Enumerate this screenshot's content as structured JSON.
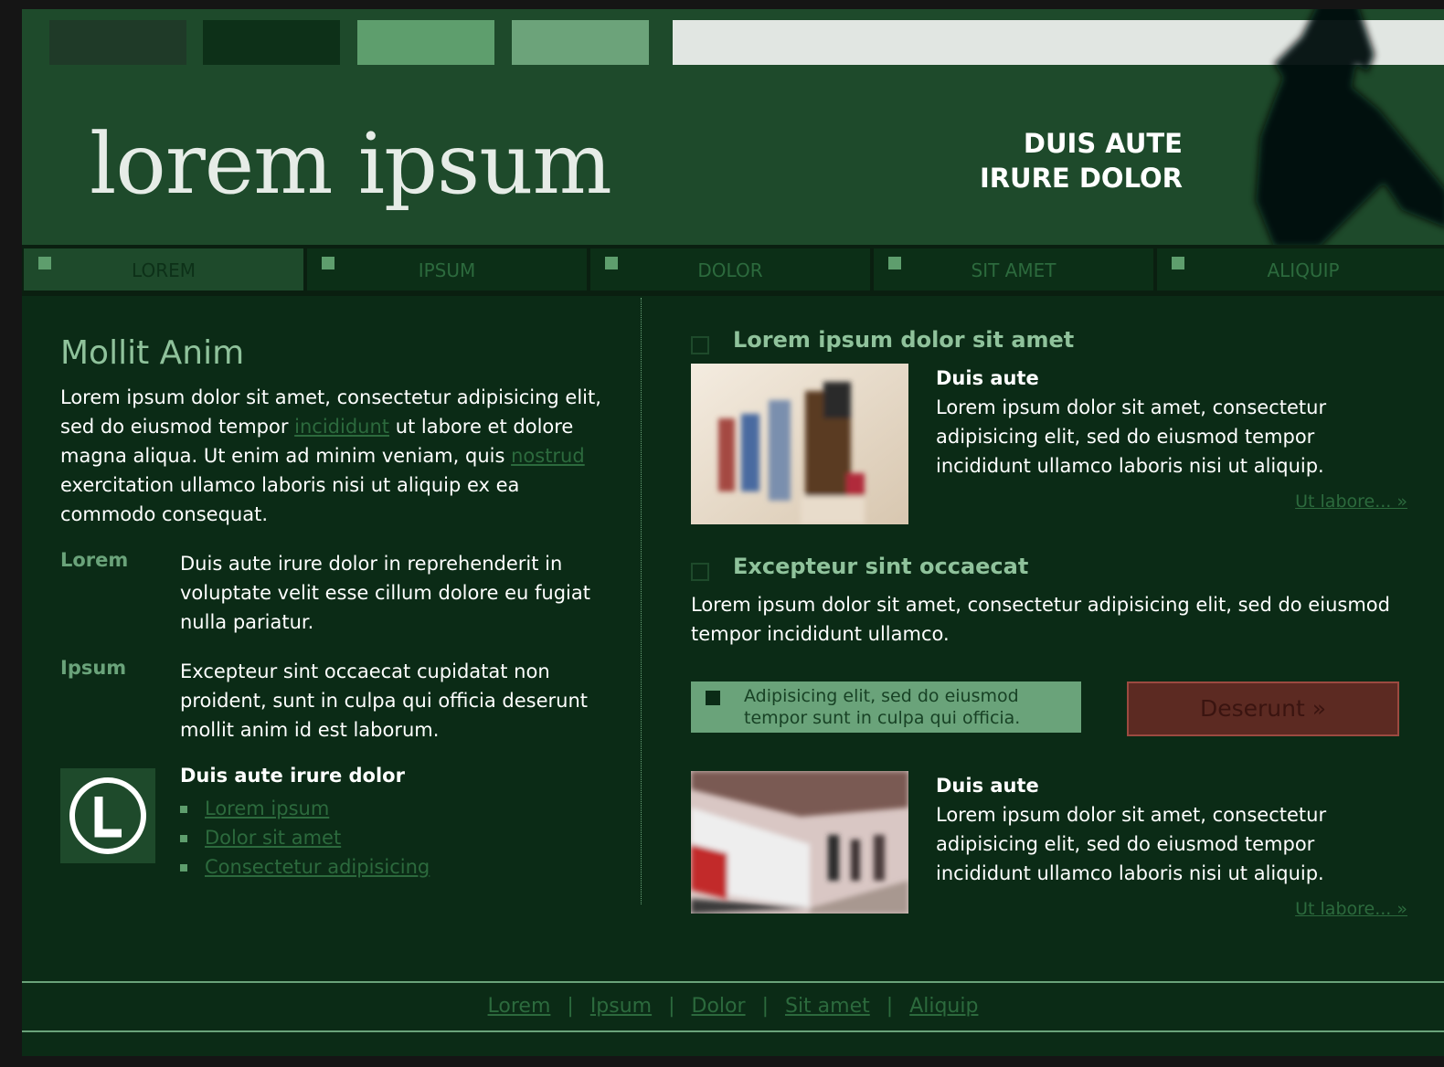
{
  "header": {
    "logo_text": "lorem ipsum",
    "tagline_line1": "DUIS AUTE",
    "tagline_line2": "IRURE DOLOR",
    "swatch_colors": [
      "#1f3a28",
      "#0d3018",
      "#5e9e6d",
      "#6ca37a"
    ]
  },
  "nav": {
    "items": [
      "LOREM",
      "IPSUM",
      "DOLOR",
      "SIT AMET",
      "ALIQUIP"
    ],
    "active_index": 0
  },
  "left": {
    "title": "Mollit Anim",
    "intro_part1": "Lorem ipsum dolor sit amet, consectetur adipisicing elit, sed do eiusmod tempor ",
    "intro_link1": "incididunt",
    "intro_part2": " ut labore et dolore magna aliqua. Ut enim ad minim veniam, quis ",
    "intro_link2": "nostrud",
    "intro_part3": " exercitation ullamco laboris nisi ut aliquip ex ea commodo consequat.",
    "definitions": [
      {
        "term": "Lorem",
        "desc": "Duis aute irure dolor in reprehenderit in voluptate velit esse cillum dolore eu fugiat nulla pariatur."
      },
      {
        "term": "Ipsum",
        "desc": "Excepteur sint occaecat cupidatat non proident, sunt in culpa qui officia deserunt mollit anim id est laborum."
      }
    ],
    "links_title": "Duis aute irure dolor",
    "links": [
      "Lorem ipsum",
      "Dolor sit amet",
      "Consectetur adipisicing"
    ]
  },
  "right": {
    "section1_title": "Lorem ipsum dolor sit amet",
    "feature1": {
      "title": "Duis aute",
      "body": "Lorem ipsum dolor sit amet, consectetur adipisicing elit, sed do eiusmod tempor incididunt ullamco laboris nisi ut aliquip.",
      "more": "Ut labore... »"
    },
    "section2_title": "Excepteur sint occaecat",
    "section2_body": "Lorem ipsum dolor sit amet, consectetur adipisicing elit, sed do eiusmod tempor incididunt ullamco.",
    "promo_text": "Adipisicing elit, sed do eiusmod tempor sunt in culpa qui officia.",
    "cta_label": "Deserunt »",
    "feature2": {
      "title": "Duis aute",
      "body": "Lorem ipsum dolor sit amet, consectetur adipisicing elit, sed do eiusmod tempor incididunt ullamco laboris nisi ut aliquip.",
      "more": "Ut labore... »"
    }
  },
  "footer": {
    "links": [
      "Lorem",
      "Ipsum",
      "Dolor",
      "Sit amet",
      "Aliquip"
    ],
    "separator": "|"
  }
}
